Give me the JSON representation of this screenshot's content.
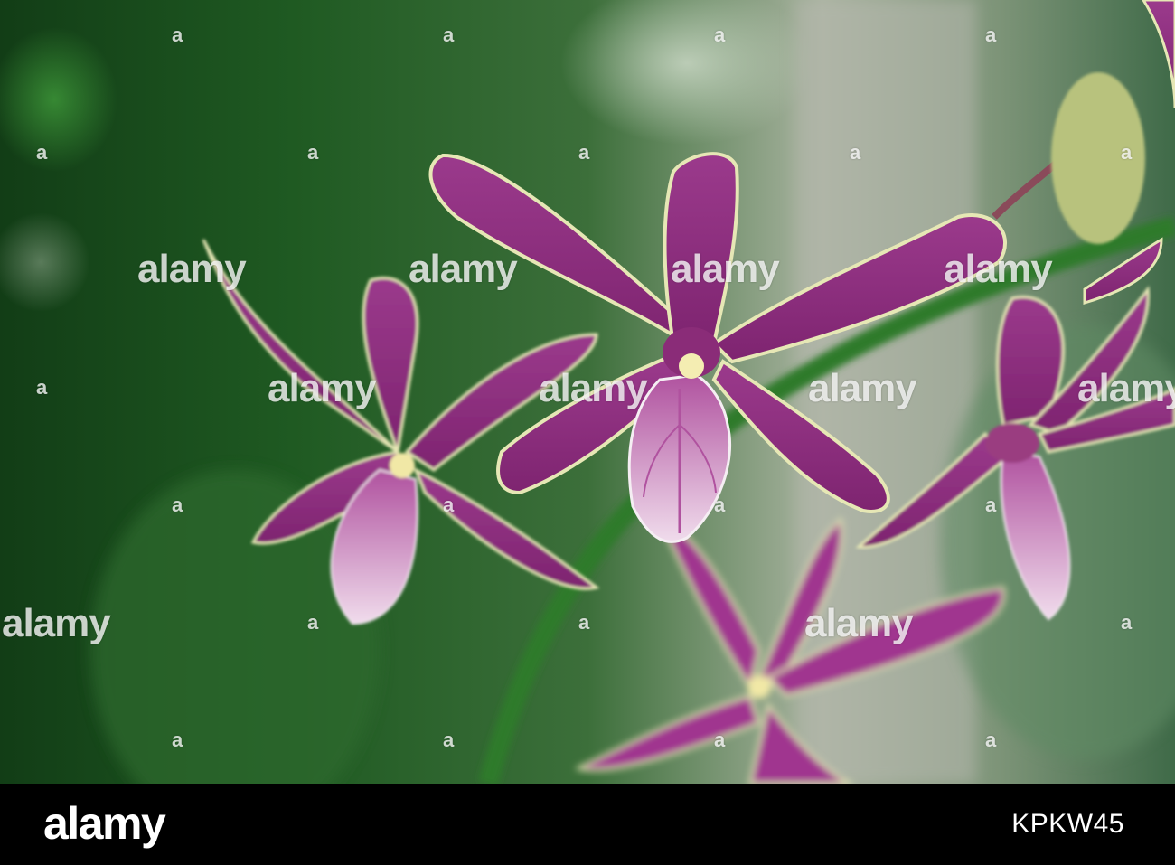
{
  "image": {
    "subject": "pink-purple orchid flowers on stem",
    "colors": {
      "background_green": "#1f5a22",
      "petal": "#8e2a7e",
      "petal_edge": "#e6e7b5",
      "lip": "#e9cfe4"
    }
  },
  "watermark": {
    "word": "alamy",
    "letter": "a"
  },
  "footer": {
    "logo": "alamy",
    "image_id": "KPKW45"
  }
}
